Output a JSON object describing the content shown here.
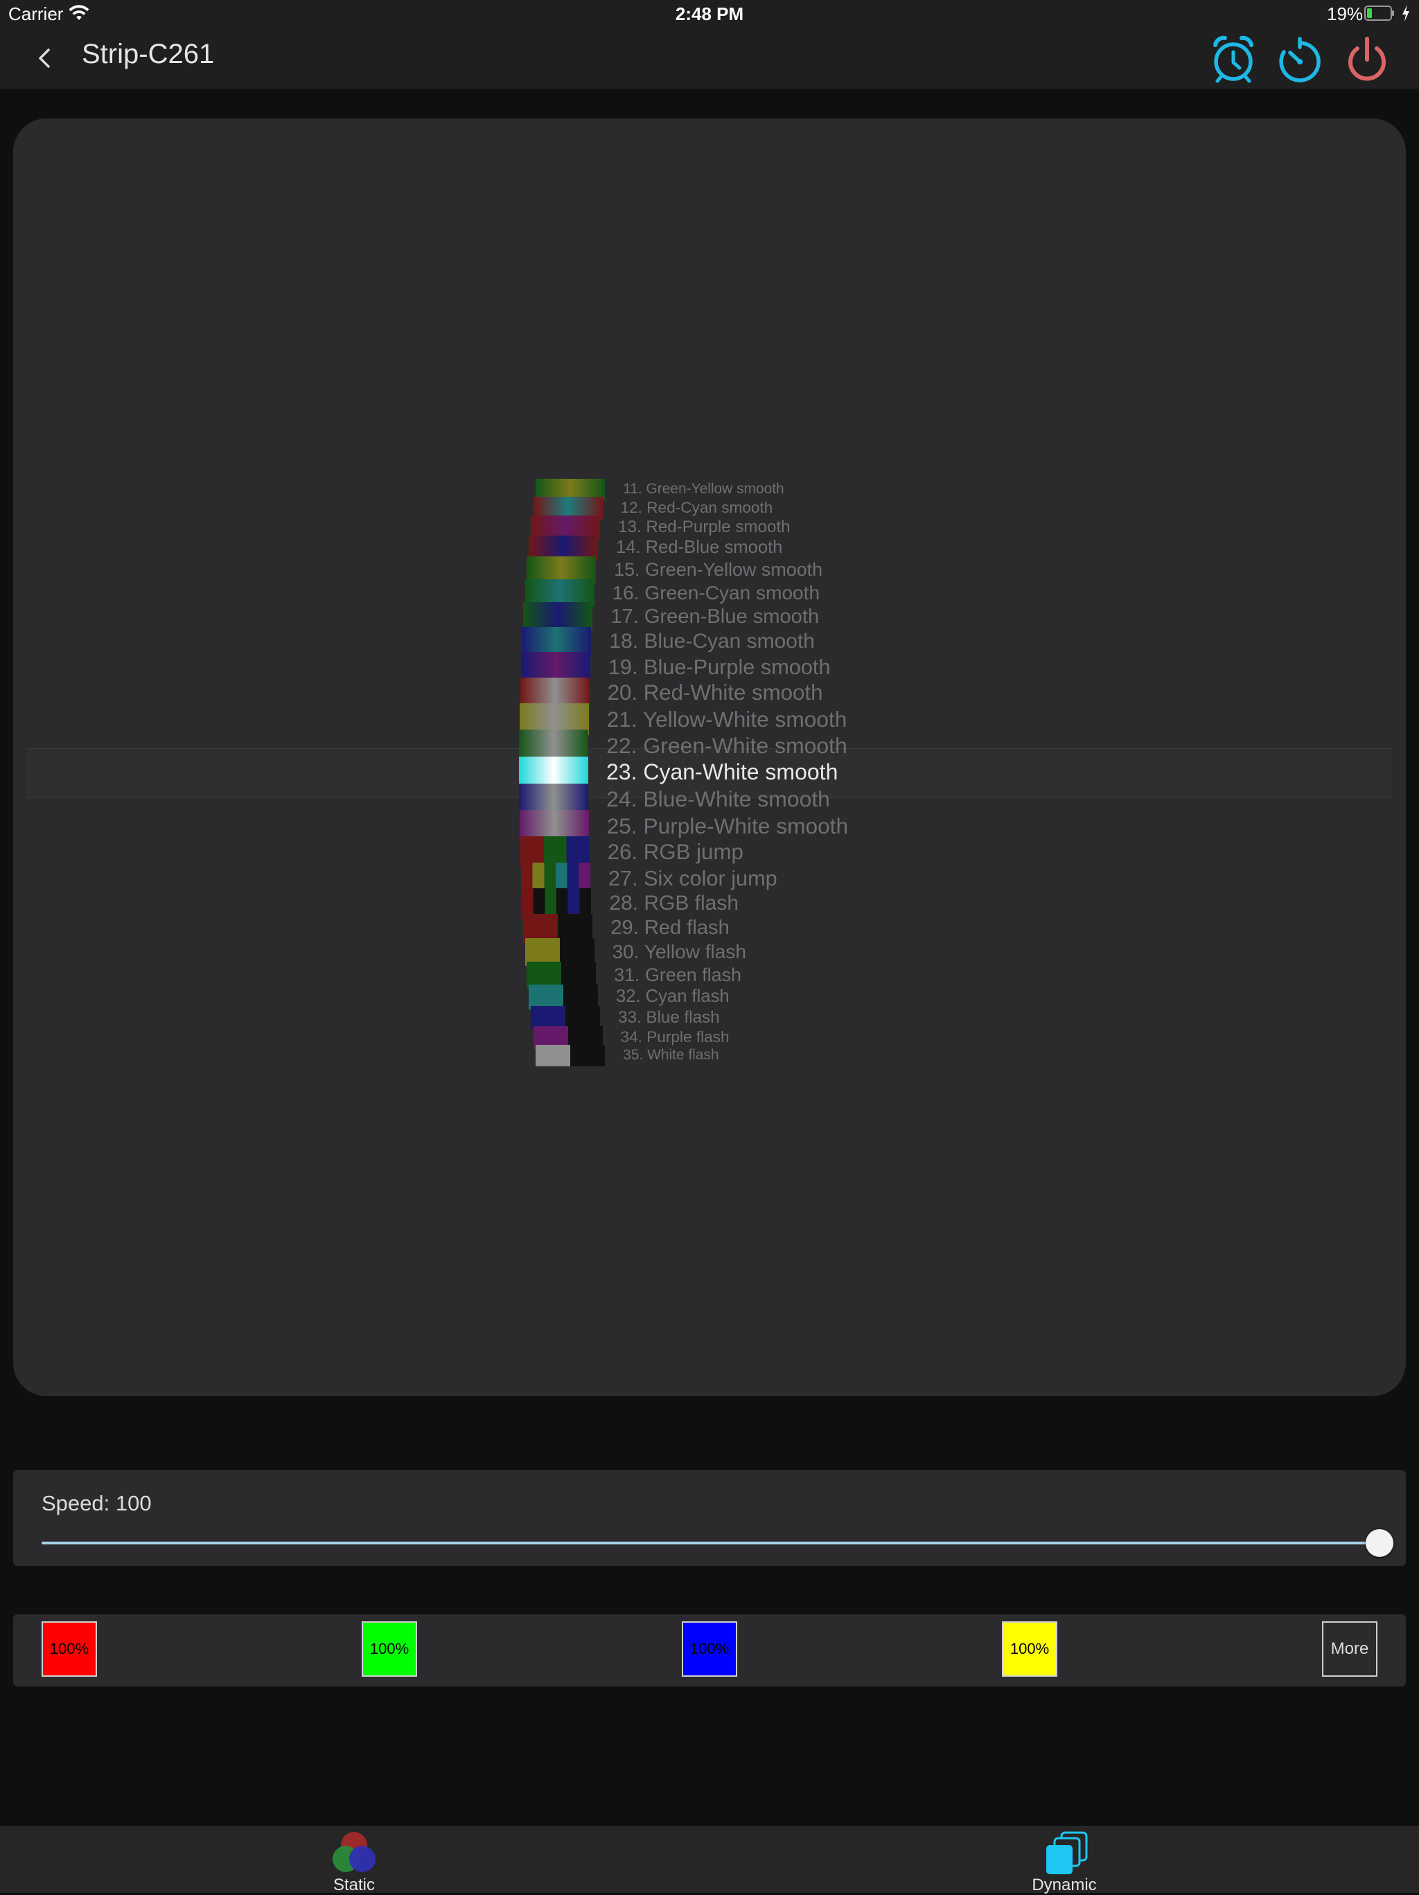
{
  "status_bar": {
    "carrier": "Carrier",
    "time": "2:48 PM",
    "battery": "19%"
  },
  "nav": {
    "title": "Strip-C261",
    "back_icon": "chevron-left-icon",
    "icons": [
      "alarm-clock-icon",
      "timer-icon",
      "power-icon"
    ]
  },
  "modes": {
    "selected": "23. Cyan-White smooth",
    "items": [
      {
        "label": "11. Green-Yellow smooth",
        "colors": [
          "#1f8a24",
          "#c8c62d"
        ],
        "style": "smooth"
      },
      {
        "label": "12. Red-Cyan smooth",
        "colors": [
          "#b82424",
          "#2fc8c8"
        ],
        "style": "smooth"
      },
      {
        "label": "13. Red-Purple smooth",
        "colors": [
          "#b82424",
          "#a22aa8"
        ],
        "style": "smooth"
      },
      {
        "label": "14. Red-Blue smooth",
        "colors": [
          "#b82424",
          "#2a2ab8"
        ],
        "style": "smooth"
      },
      {
        "label": "15. Green-Yellow smooth",
        "colors": [
          "#1f8a24",
          "#c8c62d"
        ],
        "style": "smooth"
      },
      {
        "label": "16. Green-Cyan smooth",
        "colors": [
          "#1f8a24",
          "#2fb8b8"
        ],
        "style": "smooth"
      },
      {
        "label": "17. Green-Blue smooth",
        "colors": [
          "#1f8a24",
          "#2a2ab8"
        ],
        "style": "smooth"
      },
      {
        "label": "18. Blue-Cyan smooth",
        "colors": [
          "#2a2ab8",
          "#2fb8b8"
        ],
        "style": "smooth"
      },
      {
        "label": "19. Blue-Purple smooth",
        "colors": [
          "#2a2ab8",
          "#a22aa8"
        ],
        "style": "smooth"
      },
      {
        "label": "20. Red-White smooth",
        "colors": [
          "#b82424",
          "#e8e8e8"
        ],
        "style": "smooth"
      },
      {
        "label": "21. Yellow-White smooth",
        "colors": [
          "#c8c62d",
          "#e8e8e8"
        ],
        "style": "smooth"
      },
      {
        "label": "22. Green-White smooth",
        "colors": [
          "#1f8a24",
          "#e8e8e8"
        ],
        "style": "smooth"
      },
      {
        "label": "23. Cyan-White smooth",
        "colors": [
          "#1fd6d8",
          "#ffffff"
        ],
        "style": "smooth"
      },
      {
        "label": "24. Blue-White smooth",
        "colors": [
          "#2a2ab8",
          "#e8e8e8"
        ],
        "style": "smooth"
      },
      {
        "label": "25. Purple-White smooth",
        "colors": [
          "#a22aa8",
          "#e8e8e8"
        ],
        "style": "smooth"
      },
      {
        "label": "26. RGB jump",
        "colors": [
          "#b82424",
          "#1f8a24",
          "#2a2ab8"
        ],
        "style": "jump"
      },
      {
        "label": "27. Six color jump",
        "colors": [
          "#b82424",
          "#c8c62d",
          "#1f8a24",
          "#2fb8b8",
          "#2a2ab8",
          "#a22aa8"
        ],
        "style": "jump"
      },
      {
        "label": "28. RGB flash",
        "colors": [
          "#b82424",
          "#1c1c1c",
          "#1f8a24",
          "#1c1c1c",
          "#2a2ab8",
          "#1c1c1c"
        ],
        "style": "jump"
      },
      {
        "label": "29. Red flash",
        "colors": [
          "#b82424",
          "#1c1c1c"
        ],
        "style": "jump"
      },
      {
        "label": "30. Yellow flash",
        "colors": [
          "#c8c62d",
          "#1c1c1c"
        ],
        "style": "jump"
      },
      {
        "label": "31. Green flash",
        "colors": [
          "#1f8a24",
          "#1c1c1c"
        ],
        "style": "jump"
      },
      {
        "label": "32. Cyan flash",
        "colors": [
          "#2fb8b8",
          "#1c1c1c"
        ],
        "style": "jump"
      },
      {
        "label": "33. Blue flash",
        "colors": [
          "#2a2ab8",
          "#1c1c1c"
        ],
        "style": "jump"
      },
      {
        "label": "34. Purple flash",
        "colors": [
          "#a22aa8",
          "#1c1c1c"
        ],
        "style": "jump"
      },
      {
        "label": "35. White flash",
        "colors": [
          "#e8e8e8",
          "#1c1c1c"
        ],
        "style": "jump"
      }
    ]
  },
  "speed": {
    "label": "Speed: 100",
    "value": 100,
    "max": 100
  },
  "colors": [
    {
      "label": "100%",
      "color": "#ff0000"
    },
    {
      "label": "100%",
      "color": "#00ff00"
    },
    {
      "label": "100%",
      "color": "#0000ff"
    },
    {
      "label": "100%",
      "color": "#ffff00"
    }
  ],
  "more_label": "More",
  "tabs": [
    {
      "label": "Static",
      "icon": "rgb-circles-icon"
    },
    {
      "label": "Dynamic",
      "icon": "stacked-squares-icon"
    }
  ],
  "theme": {
    "accent": "#1eb8e6",
    "power": "#d96565",
    "panel": "#2b2b2d"
  }
}
